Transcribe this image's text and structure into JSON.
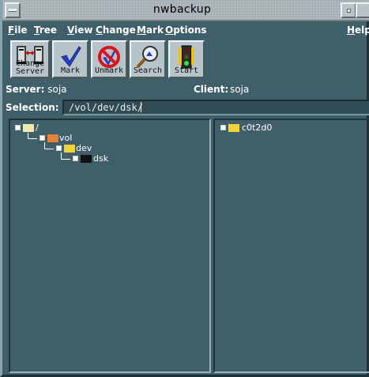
{
  "window": {
    "title": "nwbackup"
  },
  "menus": [
    {
      "label": "File",
      "u": "F",
      "rest": "ile"
    },
    {
      "label": "Tree",
      "u": "T",
      "rest": "ree"
    },
    {
      "label": "View",
      "u": "V",
      "rest": "iew"
    },
    {
      "label": "Change",
      "u": "C",
      "rest": "hange"
    },
    {
      "label": "Mark",
      "u": "M",
      "rest": "ark"
    },
    {
      "label": "Options",
      "u": "O",
      "rest": "ptions"
    },
    {
      "label": "Help",
      "u": "H",
      "rest": "elp"
    }
  ],
  "toolbar": {
    "change_server_line1": "Change",
    "change_server_line2": "Server",
    "mark": "Mark",
    "unmark": "Unmark",
    "search": "Search",
    "start": "Start"
  },
  "info": {
    "server_label": "Server:",
    "server_value": "soja",
    "client_label": "Client:",
    "client_value": "soja"
  },
  "selection": {
    "label": "Selection:",
    "value": "/vol/dev/dsk/"
  },
  "tree": [
    {
      "name": "/",
      "icon": "folder-open-icon",
      "color": "#f4e9b0"
    },
    {
      "name": "vol",
      "icon": "folder-open-icon",
      "color": "#e8823a"
    },
    {
      "name": "dev",
      "icon": "folder-open-icon",
      "color": "#f2d23a"
    },
    {
      "name": "dsk",
      "icon": "folder-closed-icon",
      "color": "#111111"
    }
  ],
  "files": [
    {
      "name": "c0t2d0",
      "icon": "folder-closed-icon",
      "color": "#f2d23a"
    }
  ]
}
